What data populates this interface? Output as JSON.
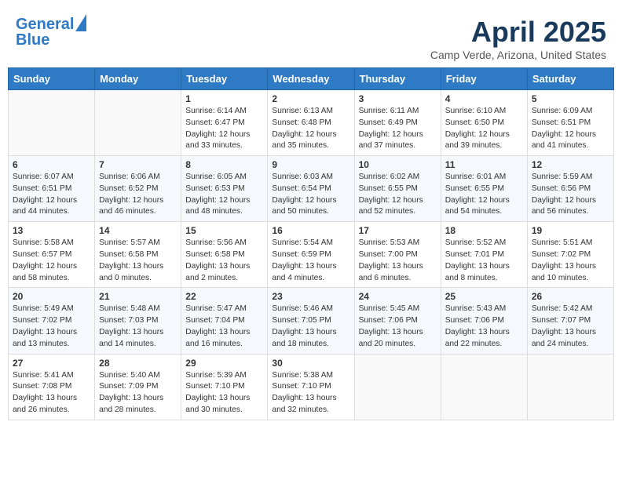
{
  "header": {
    "logo_line1": "General",
    "logo_line2": "Blue",
    "month": "April 2025",
    "location": "Camp Verde, Arizona, United States"
  },
  "days_of_week": [
    "Sunday",
    "Monday",
    "Tuesday",
    "Wednesday",
    "Thursday",
    "Friday",
    "Saturday"
  ],
  "weeks": [
    [
      {
        "day": "",
        "info": ""
      },
      {
        "day": "",
        "info": ""
      },
      {
        "day": "1",
        "info": "Sunrise: 6:14 AM\nSunset: 6:47 PM\nDaylight: 12 hours\nand 33 minutes."
      },
      {
        "day": "2",
        "info": "Sunrise: 6:13 AM\nSunset: 6:48 PM\nDaylight: 12 hours\nand 35 minutes."
      },
      {
        "day": "3",
        "info": "Sunrise: 6:11 AM\nSunset: 6:49 PM\nDaylight: 12 hours\nand 37 minutes."
      },
      {
        "day": "4",
        "info": "Sunrise: 6:10 AM\nSunset: 6:50 PM\nDaylight: 12 hours\nand 39 minutes."
      },
      {
        "day": "5",
        "info": "Sunrise: 6:09 AM\nSunset: 6:51 PM\nDaylight: 12 hours\nand 41 minutes."
      }
    ],
    [
      {
        "day": "6",
        "info": "Sunrise: 6:07 AM\nSunset: 6:51 PM\nDaylight: 12 hours\nand 44 minutes."
      },
      {
        "day": "7",
        "info": "Sunrise: 6:06 AM\nSunset: 6:52 PM\nDaylight: 12 hours\nand 46 minutes."
      },
      {
        "day": "8",
        "info": "Sunrise: 6:05 AM\nSunset: 6:53 PM\nDaylight: 12 hours\nand 48 minutes."
      },
      {
        "day": "9",
        "info": "Sunrise: 6:03 AM\nSunset: 6:54 PM\nDaylight: 12 hours\nand 50 minutes."
      },
      {
        "day": "10",
        "info": "Sunrise: 6:02 AM\nSunset: 6:55 PM\nDaylight: 12 hours\nand 52 minutes."
      },
      {
        "day": "11",
        "info": "Sunrise: 6:01 AM\nSunset: 6:55 PM\nDaylight: 12 hours\nand 54 minutes."
      },
      {
        "day": "12",
        "info": "Sunrise: 5:59 AM\nSunset: 6:56 PM\nDaylight: 12 hours\nand 56 minutes."
      }
    ],
    [
      {
        "day": "13",
        "info": "Sunrise: 5:58 AM\nSunset: 6:57 PM\nDaylight: 12 hours\nand 58 minutes."
      },
      {
        "day": "14",
        "info": "Sunrise: 5:57 AM\nSunset: 6:58 PM\nDaylight: 13 hours\nand 0 minutes."
      },
      {
        "day": "15",
        "info": "Sunrise: 5:56 AM\nSunset: 6:58 PM\nDaylight: 13 hours\nand 2 minutes."
      },
      {
        "day": "16",
        "info": "Sunrise: 5:54 AM\nSunset: 6:59 PM\nDaylight: 13 hours\nand 4 minutes."
      },
      {
        "day": "17",
        "info": "Sunrise: 5:53 AM\nSunset: 7:00 PM\nDaylight: 13 hours\nand 6 minutes."
      },
      {
        "day": "18",
        "info": "Sunrise: 5:52 AM\nSunset: 7:01 PM\nDaylight: 13 hours\nand 8 minutes."
      },
      {
        "day": "19",
        "info": "Sunrise: 5:51 AM\nSunset: 7:02 PM\nDaylight: 13 hours\nand 10 minutes."
      }
    ],
    [
      {
        "day": "20",
        "info": "Sunrise: 5:49 AM\nSunset: 7:02 PM\nDaylight: 13 hours\nand 13 minutes."
      },
      {
        "day": "21",
        "info": "Sunrise: 5:48 AM\nSunset: 7:03 PM\nDaylight: 13 hours\nand 14 minutes."
      },
      {
        "day": "22",
        "info": "Sunrise: 5:47 AM\nSunset: 7:04 PM\nDaylight: 13 hours\nand 16 minutes."
      },
      {
        "day": "23",
        "info": "Sunrise: 5:46 AM\nSunset: 7:05 PM\nDaylight: 13 hours\nand 18 minutes."
      },
      {
        "day": "24",
        "info": "Sunrise: 5:45 AM\nSunset: 7:06 PM\nDaylight: 13 hours\nand 20 minutes."
      },
      {
        "day": "25",
        "info": "Sunrise: 5:43 AM\nSunset: 7:06 PM\nDaylight: 13 hours\nand 22 minutes."
      },
      {
        "day": "26",
        "info": "Sunrise: 5:42 AM\nSunset: 7:07 PM\nDaylight: 13 hours\nand 24 minutes."
      }
    ],
    [
      {
        "day": "27",
        "info": "Sunrise: 5:41 AM\nSunset: 7:08 PM\nDaylight: 13 hours\nand 26 minutes."
      },
      {
        "day": "28",
        "info": "Sunrise: 5:40 AM\nSunset: 7:09 PM\nDaylight: 13 hours\nand 28 minutes."
      },
      {
        "day": "29",
        "info": "Sunrise: 5:39 AM\nSunset: 7:10 PM\nDaylight: 13 hours\nand 30 minutes."
      },
      {
        "day": "30",
        "info": "Sunrise: 5:38 AM\nSunset: 7:10 PM\nDaylight: 13 hours\nand 32 minutes."
      },
      {
        "day": "",
        "info": ""
      },
      {
        "day": "",
        "info": ""
      },
      {
        "day": "",
        "info": ""
      }
    ]
  ]
}
